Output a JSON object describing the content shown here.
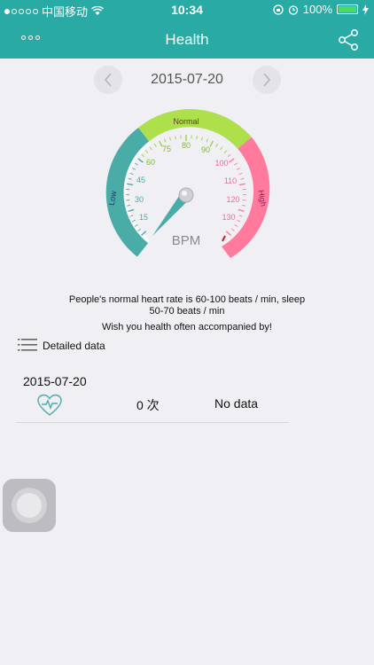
{
  "status_bar": {
    "carrier": "中国移动",
    "time": "10:34",
    "battery": "100%"
  },
  "nav": {
    "title": "Health"
  },
  "date_selector": {
    "date": "2015-07-20"
  },
  "gauge": {
    "normal_label": "Normal",
    "low_label": "Low",
    "high_label": "High",
    "unit": "BPM",
    "ticks": [
      "15",
      "30",
      "45",
      "60",
      "75",
      "80",
      "90",
      "100",
      "110",
      "120",
      "130"
    ],
    "colors": {
      "low": "#4aaca6",
      "normal": "#aee04c",
      "high": "#ff7a9c",
      "needle": "#4aaca6"
    }
  },
  "info": {
    "line1": "People's normal heart rate is 60-100 beats / min, sleep",
    "line2": "50-70 beats / min",
    "line3": "Wish you health often accompanied by!"
  },
  "detailed": {
    "label": "Detailed data"
  },
  "record": {
    "date": "2015-07-20",
    "count": "0  次",
    "status": "No data"
  }
}
